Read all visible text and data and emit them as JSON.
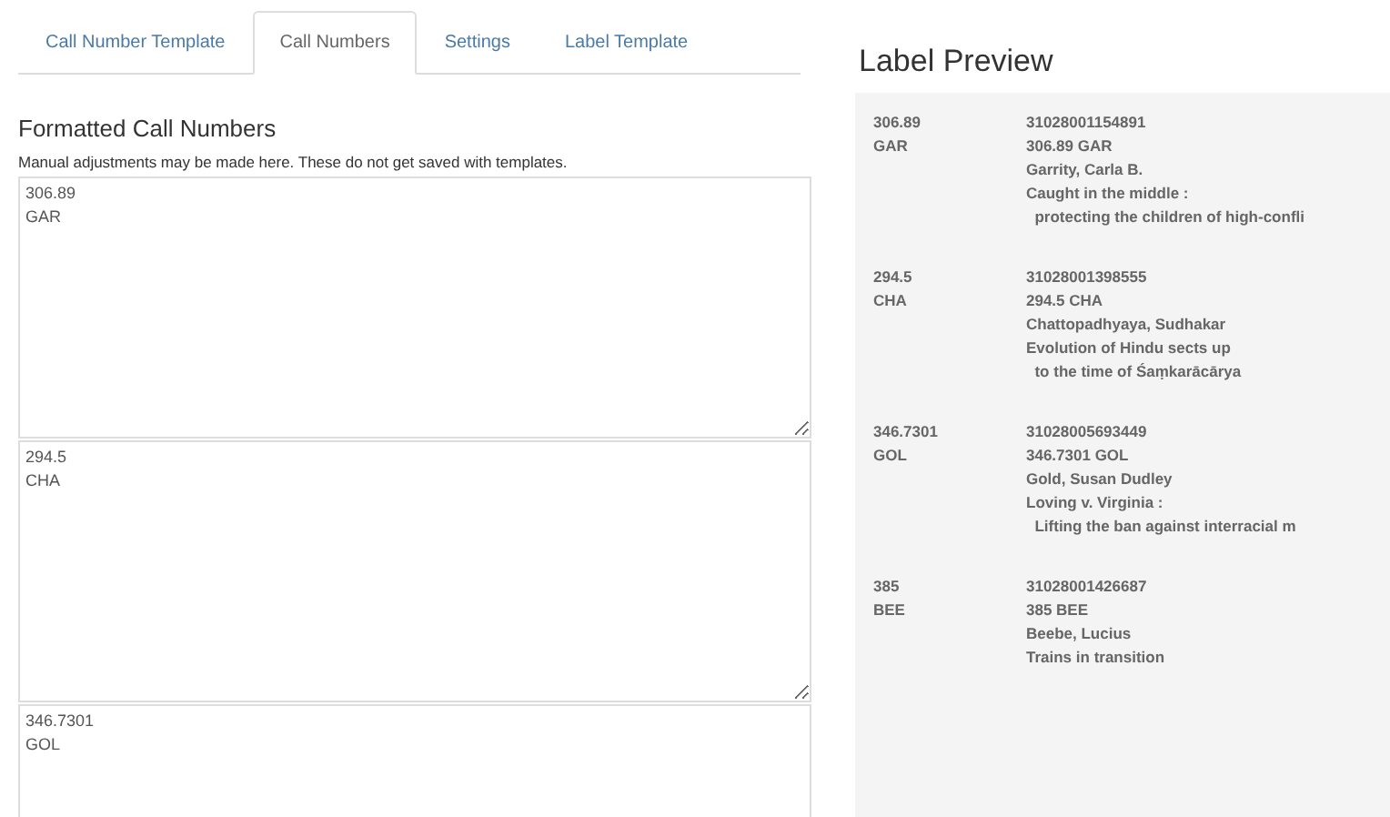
{
  "tabs": [
    {
      "label": "Call Number Template",
      "selected": false
    },
    {
      "label": "Call Numbers",
      "selected": true
    },
    {
      "label": "Settings",
      "selected": false
    },
    {
      "label": "Label Template",
      "selected": false
    }
  ],
  "editor": {
    "heading": "Formatted Call Numbers",
    "note": "Manual adjustments may be made here. These do not get saved with templates.",
    "call_numbers": [
      {
        "lines": [
          "306.89",
          "GAR"
        ]
      },
      {
        "lines": [
          "294.5",
          "CHA"
        ]
      },
      {
        "lines": [
          "346.7301",
          "GOL"
        ]
      }
    ]
  },
  "preview": {
    "title": "Label Preview",
    "labels": [
      {
        "spine": [
          "306.89",
          "GAR"
        ],
        "lines": [
          "31028001154891",
          "306.89 GAR",
          "Garrity, Carla B.",
          "Caught in the middle :",
          "  protecting the children of high-confli"
        ]
      },
      {
        "spine": [
          "294.5",
          "CHA"
        ],
        "lines": [
          "31028001398555",
          "294.5 CHA",
          "Chattopadhyaya, Sudhakar",
          "Evolution of Hindu sects up",
          "  to the time of Śaṃkarācārya"
        ]
      },
      {
        "spine": [
          "346.7301",
          "GOL"
        ],
        "lines": [
          "31028005693449",
          "346.7301 GOL",
          "Gold, Susan Dudley",
          "Loving v. Virginia :",
          "  Lifting the ban against interracial m"
        ]
      },
      {
        "spine": [
          "385",
          "BEE"
        ],
        "lines": [
          "31028001426687",
          "385 BEE",
          "Beebe, Lucius",
          "Trains in transition"
        ]
      }
    ]
  }
}
